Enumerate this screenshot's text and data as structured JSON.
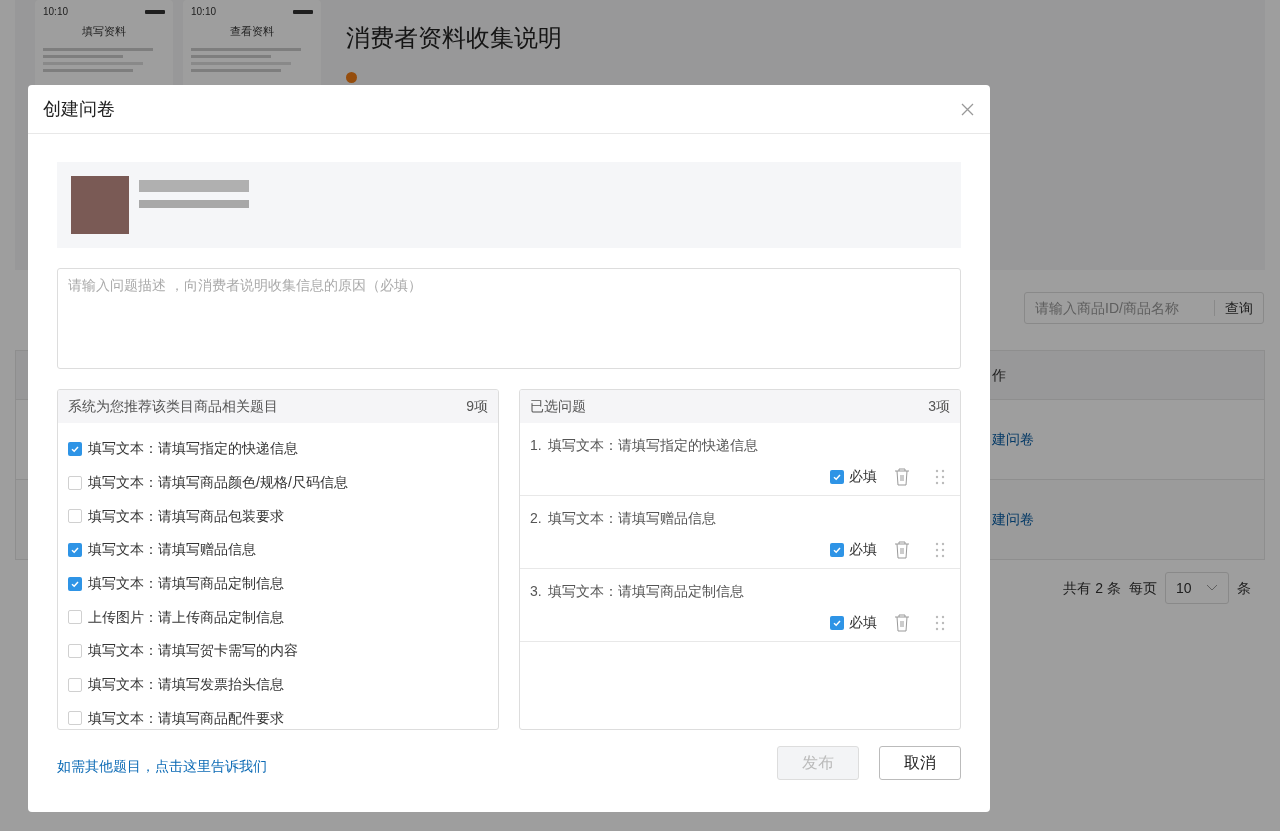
{
  "background_page": {
    "previews": [
      {
        "time": "10:10",
        "title": "填写资料"
      },
      {
        "time": "10:10",
        "title": "查看资料"
      }
    ],
    "heading": "消费者资料收集说明",
    "search": {
      "placeholder": "请输入商品ID/商品名称",
      "button": "查询"
    },
    "table": {
      "columns": [
        "作"
      ],
      "rows": [
        {
          "action": "建问卷"
        },
        {
          "action": "建问卷"
        }
      ]
    },
    "pagination": {
      "total": "共有 2 条",
      "per_page_label": "每页",
      "per_page": "10",
      "unit": "条"
    }
  },
  "dialog": {
    "title": "创建问卷",
    "description": {
      "placeholder": "请输入问题描述 ，向消费者说明收集信息的原因（必填）"
    },
    "recommended": {
      "title": "系统为您推荐该类目商品相关题目",
      "count": "9项",
      "items": [
        {
          "label": "填写文本：请填写指定的快递信息",
          "checked": true
        },
        {
          "label": "填写文本：请填写商品颜色/规格/尺码信息",
          "checked": false
        },
        {
          "label": "填写文本：请填写商品包装要求",
          "checked": false
        },
        {
          "label": "填写文本：请填写赠品信息",
          "checked": true
        },
        {
          "label": "填写文本：请填写商品定制信息",
          "checked": true
        },
        {
          "label": "上传图片：请上传商品定制信息",
          "checked": false
        },
        {
          "label": "填写文本：请填写贺卡需写的内容",
          "checked": false
        },
        {
          "label": "填写文本：请填写发票抬头信息",
          "checked": false
        },
        {
          "label": "填写文本：请填写商品配件要求",
          "checked": false
        }
      ]
    },
    "selected": {
      "title": "已选问题",
      "count": "3项",
      "items": [
        {
          "number": "1.",
          "label": "填写文本：请填写指定的快递信息",
          "required_label": "必填",
          "required": true
        },
        {
          "number": "2.",
          "label": "填写文本：请填写赠品信息",
          "required_label": "必填",
          "required": true
        },
        {
          "number": "3.",
          "label": "填写文本：请填写商品定制信息",
          "required_label": "必填",
          "required": true
        }
      ]
    },
    "feedback_link": "如需其他题目，点击这里告诉我们",
    "buttons": [
      {
        "label": "发布",
        "disabled": true
      },
      {
        "label": "取消",
        "disabled": false
      }
    ]
  }
}
